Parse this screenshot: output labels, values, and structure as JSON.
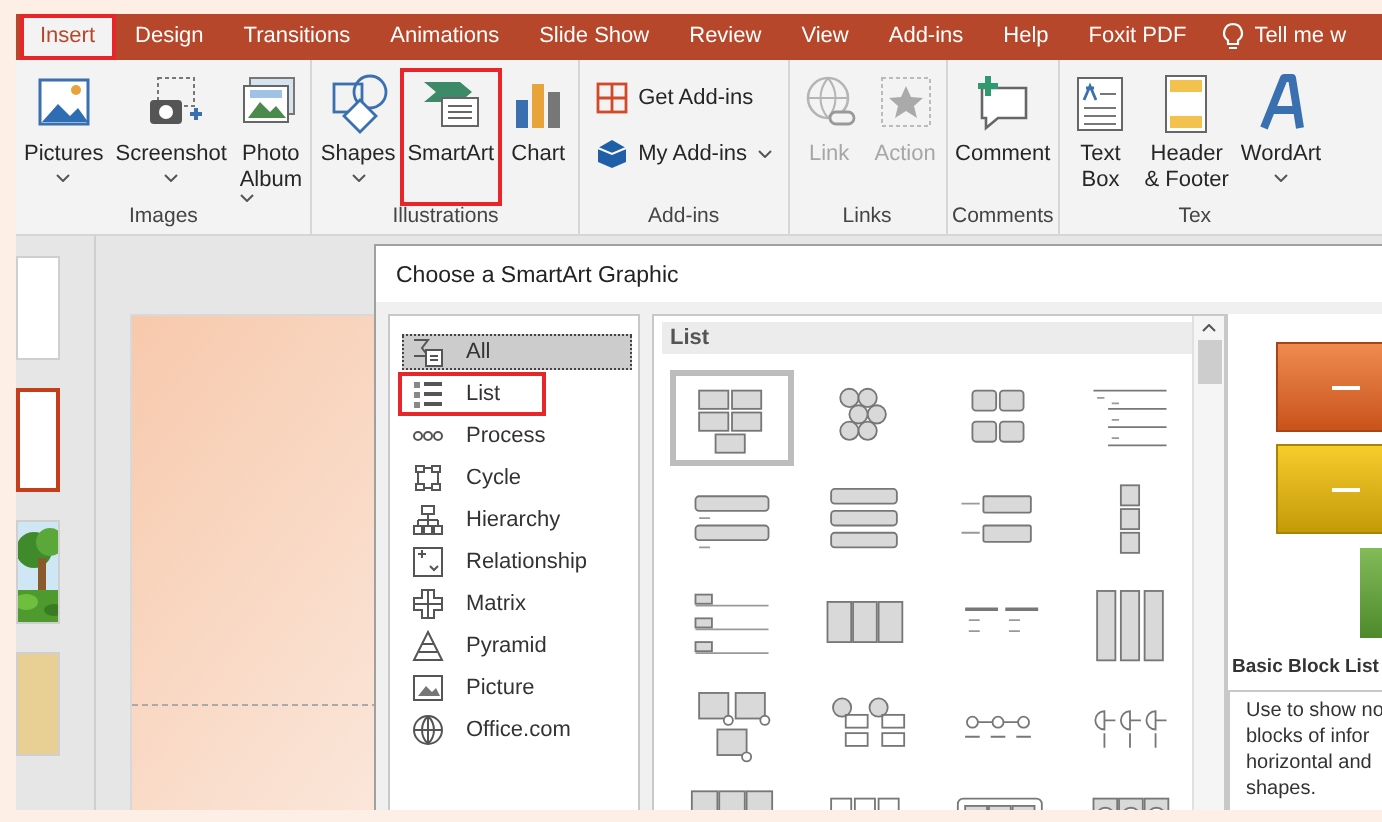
{
  "ribbon": {
    "tabs": [
      {
        "label": "Insert",
        "selected": true,
        "highlighted": true
      },
      {
        "label": "Design",
        "selected": false,
        "highlighted": false
      },
      {
        "label": "Transitions",
        "selected": false,
        "highlighted": false
      },
      {
        "label": "Animations",
        "selected": false,
        "highlighted": false
      },
      {
        "label": "Slide Show",
        "selected": false,
        "highlighted": false
      },
      {
        "label": "Review",
        "selected": false,
        "highlighted": false
      },
      {
        "label": "View",
        "selected": false,
        "highlighted": false
      },
      {
        "label": "Add-ins",
        "selected": false,
        "highlighted": false
      },
      {
        "label": "Help",
        "selected": false,
        "highlighted": false
      },
      {
        "label": "Foxit PDF",
        "selected": false,
        "highlighted": false
      }
    ],
    "tell_me": "Tell me w",
    "groups": [
      {
        "label": "Images",
        "buttons": [
          {
            "kind": "large",
            "lines": [
              "Pictures"
            ],
            "dropdown": true,
            "disabled": false,
            "highlighted": false
          },
          {
            "kind": "large",
            "lines": [
              "Screenshot"
            ],
            "dropdown": true,
            "disabled": false,
            "highlighted": false
          },
          {
            "kind": "large",
            "lines": [
              "Photo",
              "Album"
            ],
            "dropdown": true,
            "disabled": false,
            "highlighted": false
          }
        ]
      },
      {
        "label": "Illustrations",
        "buttons": [
          {
            "kind": "large",
            "lines": [
              "Shapes"
            ],
            "dropdown": true,
            "disabled": false,
            "highlighted": false
          },
          {
            "kind": "large",
            "lines": [
              "SmartArt"
            ],
            "dropdown": false,
            "disabled": false,
            "highlighted": true
          },
          {
            "kind": "large",
            "lines": [
              "Chart"
            ],
            "dropdown": false,
            "disabled": false,
            "highlighted": false
          }
        ]
      },
      {
        "label": "Add-ins",
        "buttons": [
          {
            "kind": "small",
            "lines": [
              "Get Add-ins"
            ],
            "dropdown": false,
            "disabled": false,
            "highlighted": false
          },
          {
            "kind": "small",
            "lines": [
              "My Add-ins"
            ],
            "dropdown": true,
            "disabled": false,
            "highlighted": false
          }
        ]
      },
      {
        "label": "Links",
        "buttons": [
          {
            "kind": "large",
            "lines": [
              "Link"
            ],
            "dropdown": false,
            "disabled": true,
            "highlighted": false
          },
          {
            "kind": "large",
            "lines": [
              "Action"
            ],
            "dropdown": false,
            "disabled": true,
            "highlighted": false
          }
        ]
      },
      {
        "label": "Comments",
        "buttons": [
          {
            "kind": "large",
            "lines": [
              "Comment"
            ],
            "dropdown": false,
            "disabled": false,
            "highlighted": false
          }
        ]
      },
      {
        "label": "Tex",
        "buttons": [
          {
            "kind": "large",
            "lines": [
              "Text",
              "Box"
            ],
            "dropdown": false,
            "disabled": false,
            "highlighted": false
          },
          {
            "kind": "large",
            "lines": [
              "Header",
              "& Footer"
            ],
            "dropdown": false,
            "disabled": false,
            "highlighted": false
          },
          {
            "kind": "large",
            "lines": [
              "WordArt"
            ],
            "dropdown": true,
            "disabled": false,
            "highlighted": false
          }
        ]
      }
    ]
  },
  "thumbnails": [
    {
      "kind": "blank",
      "selected": false
    },
    {
      "kind": "blank",
      "selected": true
    },
    {
      "kind": "picture",
      "selected": false
    },
    {
      "kind": "texture",
      "selected": false
    }
  ],
  "dialog": {
    "title": "Choose a SmartArt Graphic",
    "categories": [
      {
        "label": "All",
        "selected": true,
        "highlighted": false
      },
      {
        "label": "List",
        "selected": false,
        "highlighted": true
      },
      {
        "label": "Process",
        "selected": false,
        "highlighted": false
      },
      {
        "label": "Cycle",
        "selected": false,
        "highlighted": false
      },
      {
        "label": "Hierarchy",
        "selected": false,
        "highlighted": false
      },
      {
        "label": "Relationship",
        "selected": false,
        "highlighted": false
      },
      {
        "label": "Matrix",
        "selected": false,
        "highlighted": false
      },
      {
        "label": "Pyramid",
        "selected": false,
        "highlighted": false
      },
      {
        "label": "Picture",
        "selected": false,
        "highlighted": false
      },
      {
        "label": "Office.com",
        "selected": false,
        "highlighted": false
      }
    ],
    "gallery": {
      "heading": "List",
      "items": [
        {
          "selected": true
        },
        {
          "selected": false
        },
        {
          "selected": false
        },
        {
          "selected": false
        },
        {
          "selected": false
        },
        {
          "selected": false
        },
        {
          "selected": false
        },
        {
          "selected": false
        },
        {
          "selected": false
        },
        {
          "selected": false
        },
        {
          "selected": false
        },
        {
          "selected": false
        },
        {
          "selected": false
        },
        {
          "selected": false
        },
        {
          "selected": false
        },
        {
          "selected": false
        },
        {
          "selected": false
        },
        {
          "selected": false
        },
        {
          "selected": false
        },
        {
          "selected": false
        }
      ]
    },
    "preview": {
      "title": "Basic Block List",
      "description_lines": [
        "Use to show no",
        "blocks of infor",
        "horizontal and",
        "shapes."
      ]
    }
  }
}
